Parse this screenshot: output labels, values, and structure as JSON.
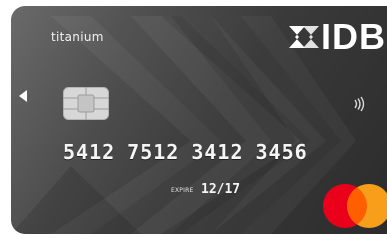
{
  "card": {
    "tier": "titanium",
    "brand": "IDB",
    "number_groups": [
      "5412",
      "7512",
      "3412",
      "3456"
    ],
    "expire_label": "EXPIRE",
    "expiry": "12/17",
    "network": "mastercard"
  },
  "colors": {
    "card_dark": "#2c2c2c",
    "card_light": "#6a6a6a",
    "mastercard_red": "#eb001b",
    "mastercard_orange": "#f79e1b"
  }
}
